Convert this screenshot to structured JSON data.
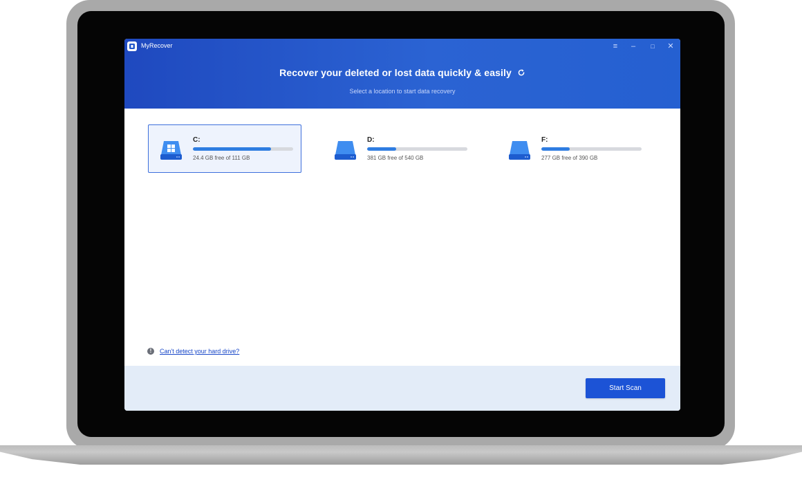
{
  "app": {
    "name": "MyRecover",
    "window_controls": [
      "≡",
      "–",
      "□",
      "✕"
    ]
  },
  "header": {
    "title": "Recover your deleted or lost data quickly & easily",
    "subtitle": "Select a location to start data recovery"
  },
  "drives": [
    {
      "name": "C:",
      "free_text": "24.4 GB free of 111 GB",
      "used_fraction": 0.78,
      "selected": true,
      "icon": "windows-drive-icon"
    },
    {
      "name": "D:",
      "free_text": "381 GB free of 540 GB",
      "used_fraction": 0.29,
      "selected": false,
      "icon": "drive-icon"
    },
    {
      "name": "F:",
      "free_text": "277 GB free of 390 GB",
      "used_fraction": 0.28,
      "selected": false,
      "icon": "drive-icon"
    }
  ],
  "help": {
    "link_text": "Can't detect your hard drive?"
  },
  "footer": {
    "scan_label": "Start Scan"
  },
  "colors": {
    "header_blue": "#2458cb",
    "accent": "#1c53d6",
    "bar_fill": "#2f7de1",
    "selected_bg": "#eef3fd"
  }
}
